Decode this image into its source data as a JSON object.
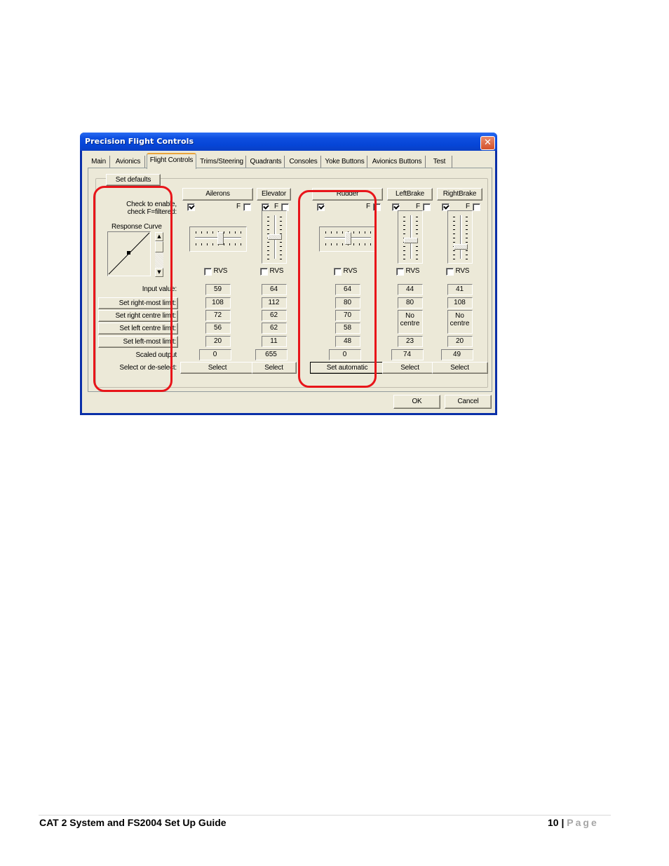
{
  "dialog": {
    "title": "Precision Flight Controls",
    "close_glyph": "✕",
    "tabs": [
      {
        "label": "Main",
        "active": false
      },
      {
        "label": "Avionics",
        "active": false
      },
      {
        "label": "Flight Controls",
        "active": true
      },
      {
        "label": "Trims/Steering",
        "active": false
      },
      {
        "label": "Quadrants",
        "active": false
      },
      {
        "label": "Consoles",
        "active": false
      },
      {
        "label": "Yoke Buttons",
        "active": false
      },
      {
        "label": "Avionics Buttons",
        "active": false
      },
      {
        "label": "Test",
        "active": false
      }
    ],
    "set_defaults_label": "Set defaults",
    "labels": {
      "check_to_enable": "Check to enable,",
      "check_filtered": "check F=filtered:",
      "response_curve": "Response Curve",
      "input_value": "Input value:",
      "set_right_most": "Set right-most limit:",
      "set_right_centre": "Set right centre limit:",
      "set_left_centre": "Set left centre limit:",
      "set_left_most": "Set left-most limit:",
      "scaled_output": "Scaled output",
      "select_deselect": "Select or de-select:"
    },
    "scroll_up_glyph": "▲",
    "scroll_down_glyph": "▼",
    "axes": [
      {
        "name": "Ailerons",
        "enabled": true,
        "filtered": false,
        "orientation": "horizontal",
        "slider_position": 0.55,
        "rvs": false,
        "rvs_label": "RVS",
        "f_label": "F",
        "input_value": "59",
        "right_most": "108",
        "right_centre": "72",
        "left_centre": "56",
        "left_most": "20",
        "scaled_output": "0",
        "action_label": "Select"
      },
      {
        "name": "Elevator",
        "enabled": true,
        "filtered": false,
        "orientation": "vertical",
        "slider_position": 0.5,
        "rvs": false,
        "rvs_label": "RVS",
        "f_label": "F",
        "input_value": "64",
        "right_most": "112",
        "right_centre": "62",
        "left_centre": "62",
        "left_most": "11",
        "scaled_output": "655",
        "action_label": "Select"
      },
      {
        "name": "Rudder",
        "enabled": true,
        "filtered": false,
        "orientation": "horizontal",
        "slider_position": 0.5,
        "rvs": false,
        "rvs_label": "RVS",
        "f_label": "F",
        "input_value": "64",
        "right_most": "80",
        "right_centre": "70",
        "left_centre": "58",
        "left_most": "48",
        "scaled_output": "0",
        "action_label": "Set automatic"
      },
      {
        "name": "LeftBrake",
        "enabled": true,
        "filtered": false,
        "orientation": "vertical",
        "slider_position": 0.6,
        "rvs": false,
        "rvs_label": "RVS",
        "f_label": "F",
        "input_value": "44",
        "right_most": "80",
        "centre_text_1": "No",
        "centre_text_2": "centre",
        "left_most": "23",
        "scaled_output": "74",
        "action_label": "Select"
      },
      {
        "name": "RightBrake",
        "enabled": true,
        "filtered": false,
        "orientation": "vertical",
        "slider_position": 0.75,
        "rvs": false,
        "rvs_label": "RVS",
        "f_label": "F",
        "input_value": "41",
        "right_most": "108",
        "centre_text_1": "No",
        "centre_text_2": "centre",
        "left_most": "20",
        "scaled_output": "49",
        "action_label": "Select"
      }
    ],
    "ok_label": "OK",
    "cancel_label": "Cancel"
  },
  "annotation_color": "#e8151a",
  "footer": {
    "title": "CAT 2 System and FS2004 Set Up Guide",
    "page_number": "10",
    "separator": " | ",
    "page_word": "Page"
  }
}
